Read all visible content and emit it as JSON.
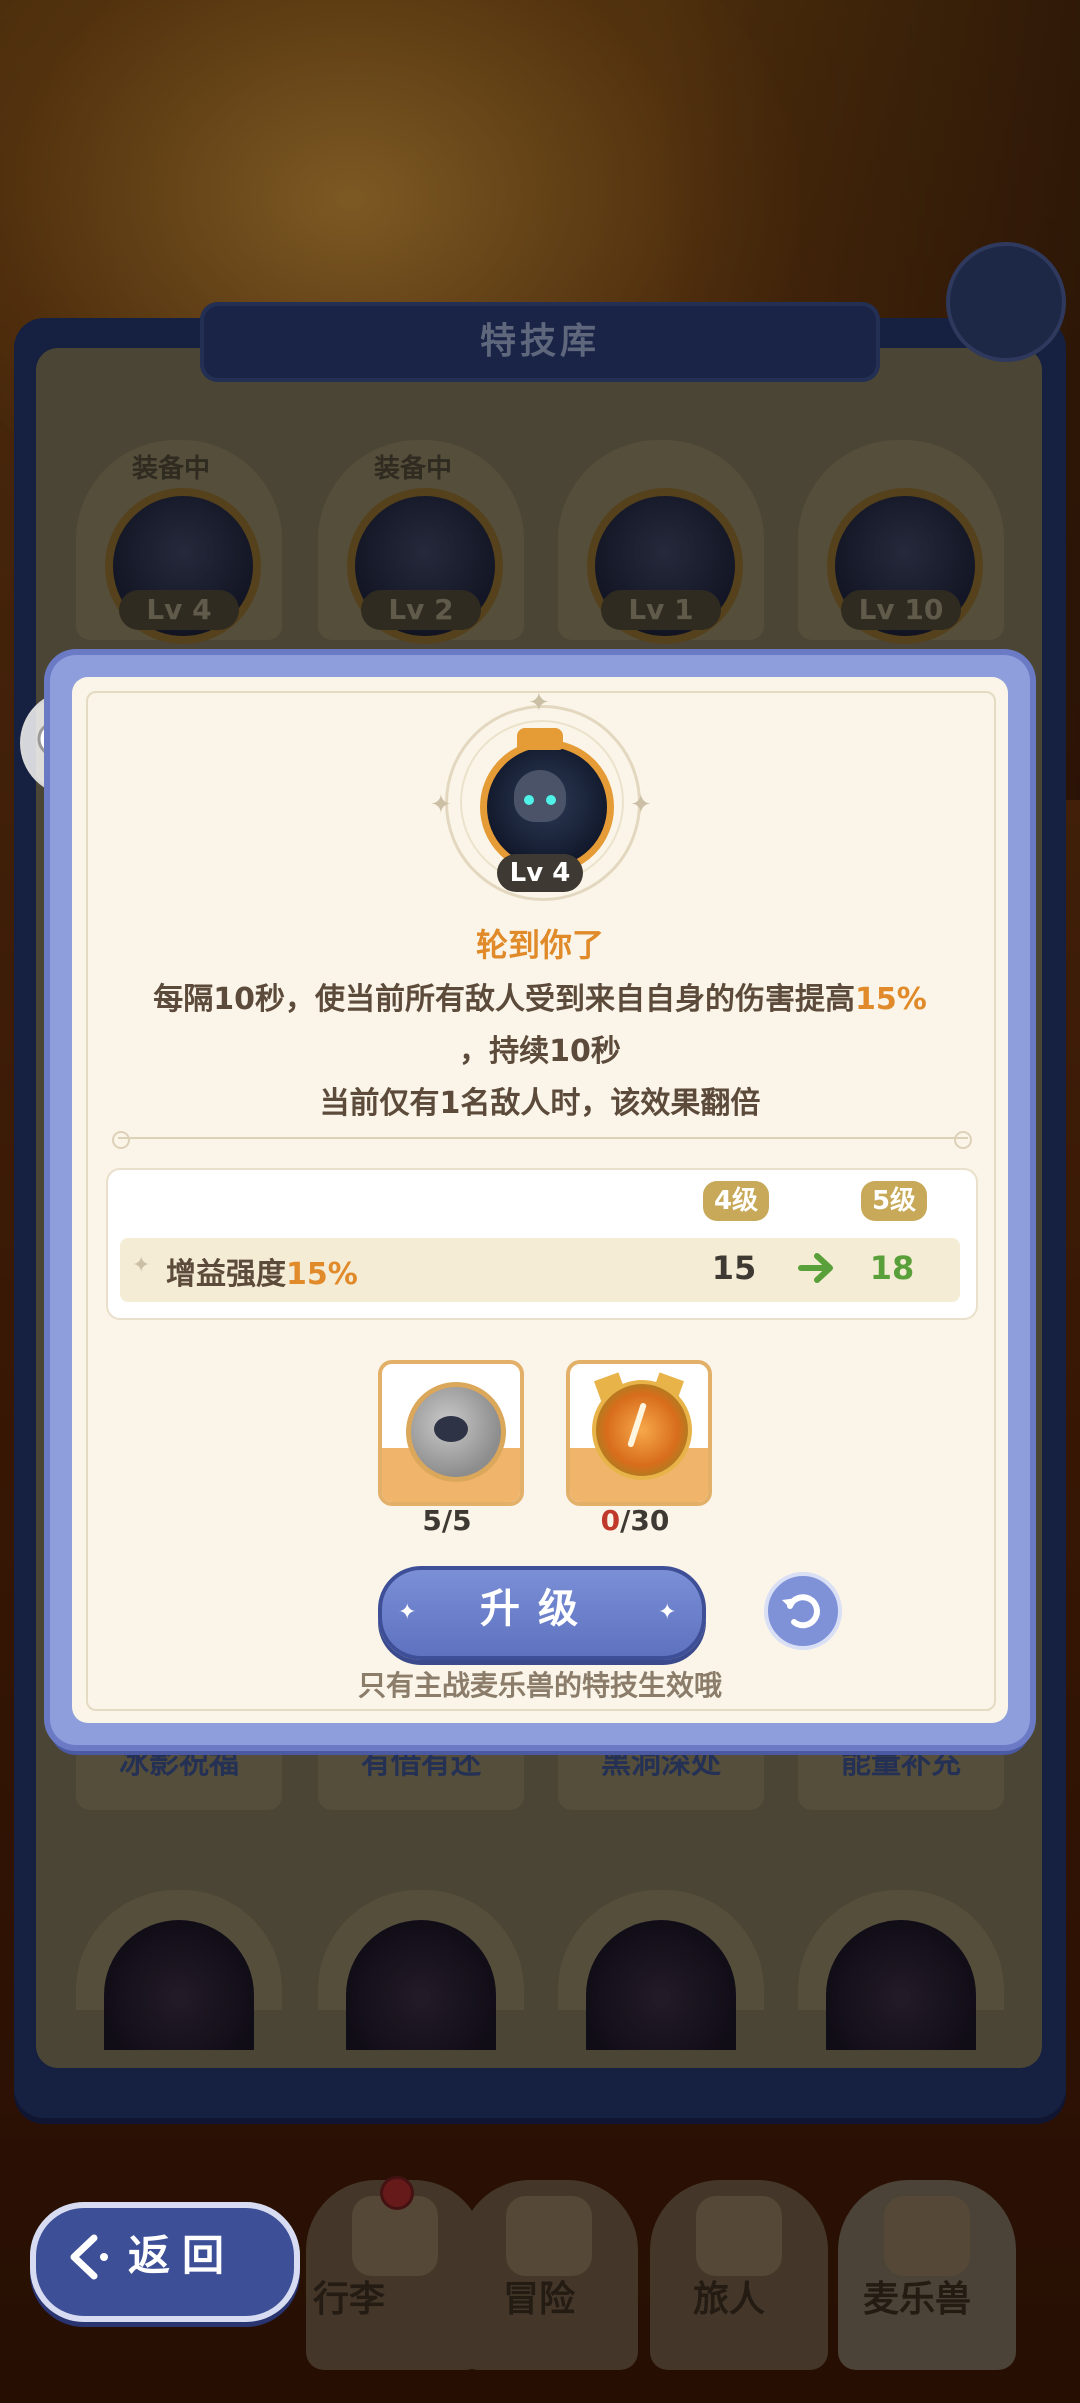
{
  "library": {
    "title": "特技库",
    "equipped_label": "装备中",
    "cards": [
      {
        "level": "Lv 4",
        "equipped": true,
        "skill": "冰影祝福"
      },
      {
        "level": "Lv 2",
        "equipped": true,
        "skill": "有借有还"
      },
      {
        "level": "Lv 1",
        "equipped": false,
        "skill": "黑洞深处"
      },
      {
        "level": "Lv 10",
        "equipped": false,
        "skill": "能量补充"
      }
    ]
  },
  "modal": {
    "skill_level": "Lv 4",
    "skill_name": "轮到你了",
    "desc_line1_a": "每隔10秒，使当前所有敌人受到来自自身的伤害提高",
    "desc_line1_b": "15%",
    "desc_line2": "，持续10秒",
    "desc_line3": "当前仅有1名敌人时，该效果翻倍",
    "current_level_label": "4级",
    "next_level_label": "5级",
    "stat": {
      "label_a": "增益强度",
      "label_b": "15%",
      "current": "15",
      "next": "18"
    },
    "materials": [
      {
        "icon": "creature-fragment-icon",
        "have": "5",
        "need": "/5"
      },
      {
        "icon": "cat-coin-icon",
        "have": "0",
        "need": "/30"
      }
    ],
    "upgrade_label": "升级",
    "tip": "只有主战麦乐兽的特技生效哦"
  },
  "nav": {
    "back_label": "返回",
    "items": [
      "行李",
      "冒险",
      "旅人",
      "麦乐兽"
    ],
    "active": "麦乐兽"
  },
  "colors": {
    "accent": "#e08a2a",
    "panel_blue": "#5e72c0",
    "positive": "#5aa03a",
    "lack": "#c0392b"
  }
}
